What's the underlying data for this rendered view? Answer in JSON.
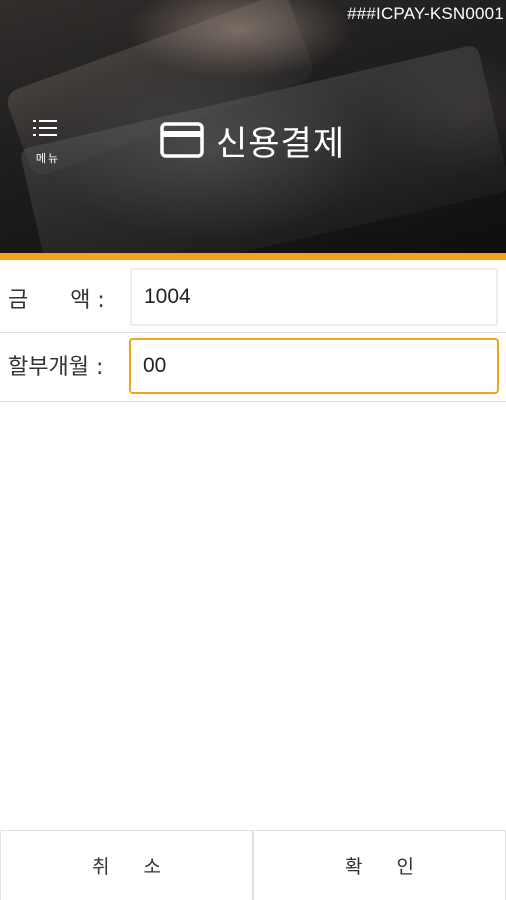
{
  "header": {
    "terminal_id": "###ICPAY-KSN0001",
    "menu_label": "메뉴",
    "title": "신용결제",
    "title_icon": "credit-card-icon",
    "accent_color": "#f5a21b"
  },
  "form": {
    "amount": {
      "label": "금      액 :",
      "value": "1004"
    },
    "installment": {
      "label": "할부개월 :",
      "value": "00"
    }
  },
  "footer": {
    "cancel_label": "취 소",
    "confirm_label": "확 인"
  }
}
